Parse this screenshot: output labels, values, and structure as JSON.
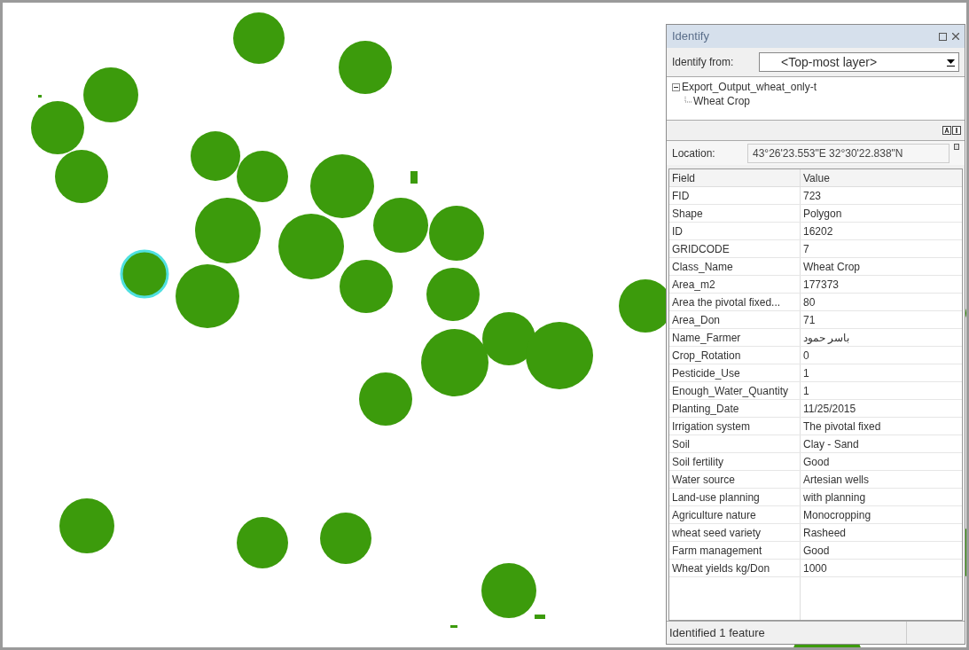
{
  "window": {
    "title": "Identify"
  },
  "identify_from": {
    "label": "Identify from:",
    "value": "<Top-most layer>"
  },
  "tree": [
    {
      "label": "Export_Output_wheat_only-t",
      "expanded": true,
      "children": [
        {
          "label": "Wheat Crop"
        }
      ]
    }
  ],
  "location": {
    "label": "Location:",
    "value": "43°26'23.553\"E  32°30'22.838\"N"
  },
  "table": {
    "columns": [
      "Field",
      "Value"
    ],
    "rows": [
      [
        "FID",
        "723"
      ],
      [
        "Shape",
        "Polygon"
      ],
      [
        "ID",
        "16202"
      ],
      [
        "GRIDCODE",
        "7"
      ],
      [
        "Class_Name",
        "Wheat Crop"
      ],
      [
        "Area_m2",
        "177373"
      ],
      [
        "Area  the pivotal fixed...",
        "80"
      ],
      [
        "Area_Don",
        "71"
      ],
      [
        "Name_Farmer",
        "باسر حمود"
      ],
      [
        "Crop_Rotation",
        "0"
      ],
      [
        "Pesticide_Use",
        "1"
      ],
      [
        "Enough_Water_Quantity",
        "1"
      ],
      [
        "Planting_Date",
        "11/25/2015"
      ],
      [
        "Irrigation system",
        "The pivotal fixed"
      ],
      [
        "Soil",
        "Clay - Sand"
      ],
      [
        "Soil fertility",
        "Good"
      ],
      [
        "Water source",
        "Artesian wells"
      ],
      [
        "Land-use planning",
        "with planning"
      ],
      [
        "Agriculture nature",
        "Monocropping"
      ],
      [
        "wheat seed variety",
        "Rasheed"
      ],
      [
        "Farm management",
        "Good"
      ],
      [
        "Wheat yields kg/Don",
        "1000"
      ]
    ]
  },
  "status_bar": "Identified 1 feature"
}
